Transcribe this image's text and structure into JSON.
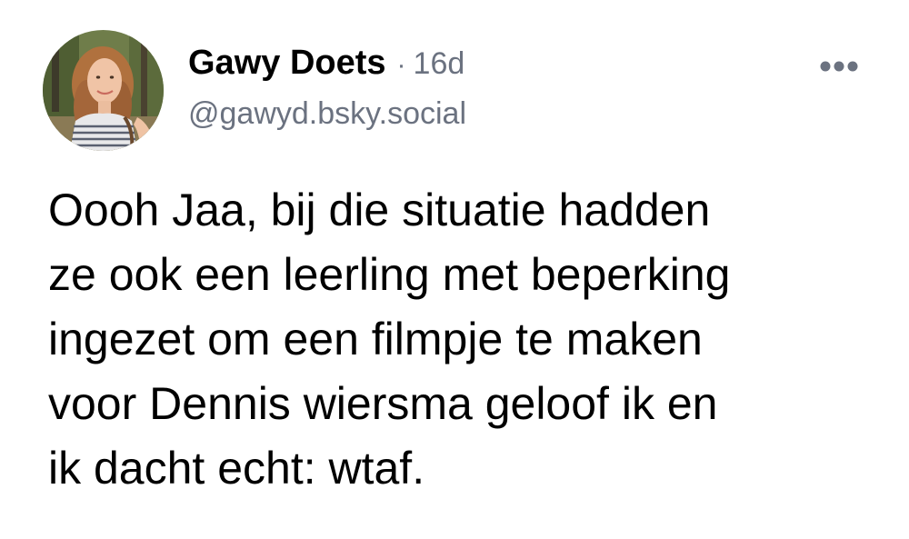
{
  "post": {
    "author": {
      "display_name": "Gawy Doets",
      "handle": "@gawyd.bsky.social",
      "avatar_icon": "user-avatar-photo"
    },
    "separator": "·",
    "timestamp": "16d",
    "more_icon": "more-horizontal-icon",
    "text": "Oooh Jaa, bij die situatie hadden\nze ook een leerling met beperking\ningezet om een filmpje te maken\nvoor Dennis wiersma geloof ik en\nik dacht echt: wtaf."
  },
  "colors": {
    "text_primary": "#000000",
    "text_secondary": "#6b7280",
    "icon_gray": "#6b7280",
    "background": "#ffffff"
  }
}
